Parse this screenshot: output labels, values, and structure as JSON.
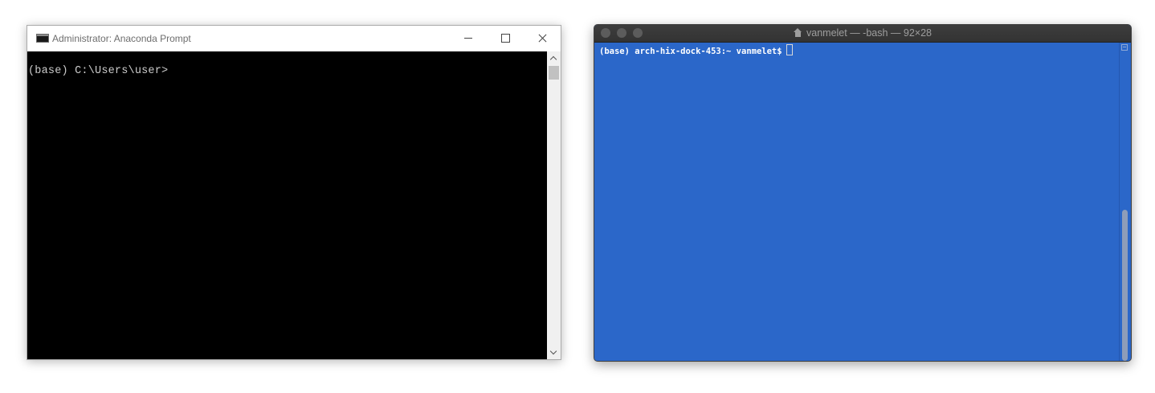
{
  "windows_console": {
    "title": "Administrator: Anaconda Prompt",
    "icon": "console-app-icon",
    "controls": [
      "minimize",
      "maximize",
      "close"
    ],
    "prompt_line": "(base) C:\\Users\\user>",
    "background_color": "#000000",
    "text_color": "#cccccc"
  },
  "mac_terminal": {
    "title": "vanmelet — -bash — 92×28",
    "title_icon": "home-icon",
    "prompt_line": "(base) arch-hix-dock-453:~ vanmelet$",
    "background_color": "#2b67c9",
    "text_color": "#ffffff"
  }
}
